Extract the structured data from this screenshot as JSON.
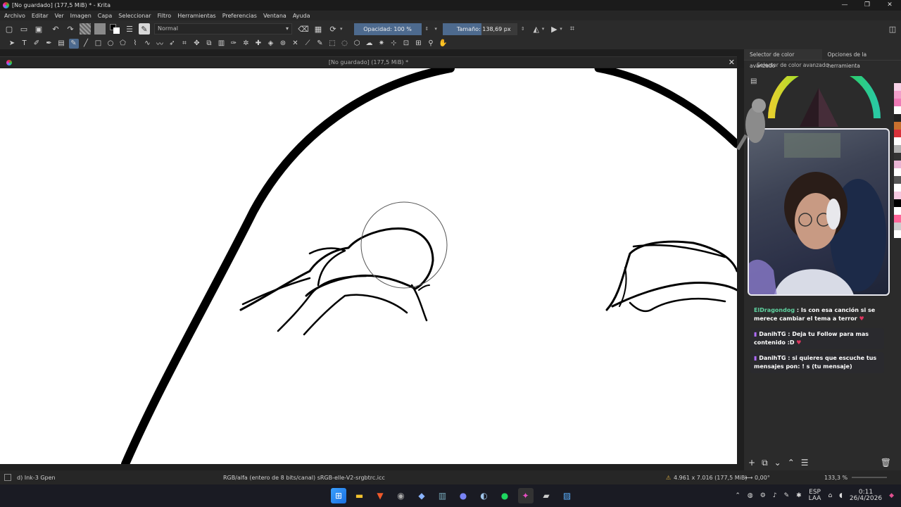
{
  "window": {
    "title": "[No guardado]  (177,5 MiB) * - Krita",
    "controls": [
      "—",
      "❐",
      "✕"
    ]
  },
  "menu": [
    "Archivo",
    "Editar",
    "Ver",
    "Imagen",
    "Capa",
    "Seleccionar",
    "Filtro",
    "Herramientas",
    "Preferencias",
    "Ventana",
    "Ayuda"
  ],
  "toolbar": {
    "blend_mode": "Normal",
    "opacity_label": "Opacidad: 100 %",
    "opacity_value": 100,
    "size_label": "Tamaño: 138,69 px"
  },
  "document_tab": {
    "title": "[No guardado]  (177,5 MiB) *",
    "close": "✕"
  },
  "docker": {
    "tab_active": "Selector de color avanzado",
    "tab_other": "Opciones de la herramienta",
    "subtitle": "Selector de color avanzado",
    "palette_colors": [
      "#f7d1e6",
      "#f29fca",
      "#ee7ab6",
      "#ffffff",
      "#222222",
      "#c8702e",
      "#d8323a",
      "#ffffff",
      "#b0b0b0",
      "#333333",
      "#e9b4d4",
      "#ffffff",
      "#555555",
      "#ffffff",
      "#f4c9e0",
      "#000000",
      "#ffffff",
      "#ff6699",
      "#cccccc",
      "#ffffff"
    ]
  },
  "chat": {
    "messages": [
      {
        "user": "ElDragondog",
        "text": ": Is con esa canción si se merece cambiar el tema a terror",
        "user_color": "#5fd3a0"
      },
      {
        "user": "DanihTG",
        "text": ": Deja tu Follow para mas contenido :D",
        "user_color": "#ffffff"
      },
      {
        "user": "DanihTG",
        "text": ": si quieres que escuche tus mensajes pon: ! s (tu mensaje)",
        "user_color": "#ffffff"
      }
    ]
  },
  "status": {
    "brush": "d) Ink-3 Gpen",
    "color_space": "RGB/alfa (entero de 8 bits/canal)  sRGB-elle-V2-srgbtrc.icc",
    "dimensions": "4.961 x 7.016 (177,5 MiB)",
    "rotation": "0,00°",
    "zoom": "133,3 %"
  },
  "taskbar": {
    "lang": "ESP",
    "lang2": "LAA",
    "time": "0:11",
    "date": "26/4/2026"
  }
}
